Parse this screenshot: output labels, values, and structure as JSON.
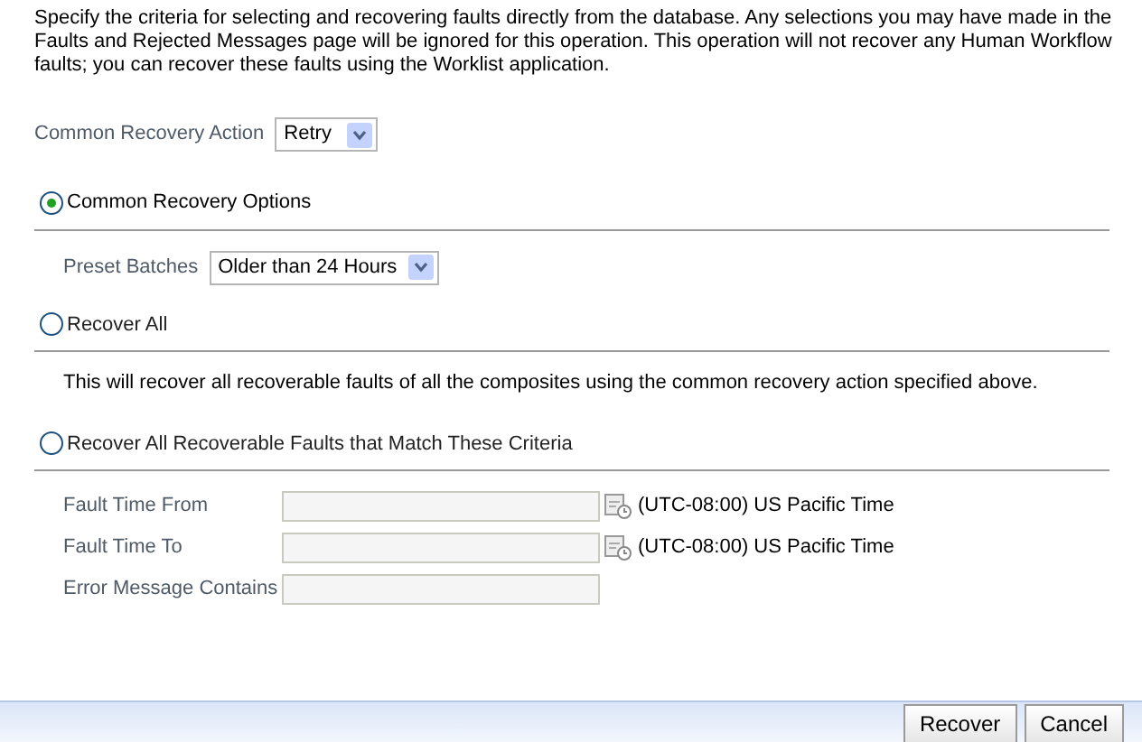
{
  "intro": "Specify the criteria for selecting and recovering faults directly from the database. Any selections you may have made in the Faults and Rejected Messages page will be ignored for this operation. This operation will not recover any Human Workflow faults; you can recover these faults using the Worklist application.",
  "recovery_action": {
    "label": "Common Recovery Action",
    "value": "Retry"
  },
  "options": [
    {
      "kind": "preset",
      "label": "Common Recovery Options",
      "selected": true,
      "preset": {
        "label": "Preset Batches",
        "value": "Older than 24 Hours"
      }
    },
    {
      "kind": "note",
      "label": "Recover All",
      "selected": false,
      "note": "This will recover all recoverable faults of all the composites using the common recovery action specified above."
    },
    {
      "kind": "criteria",
      "label": "Recover All Recoverable Faults that Match These Criteria",
      "selected": false,
      "fields": [
        {
          "label": "Fault Time From",
          "date": true,
          "timezone": "(UTC-08:00) US Pacific Time",
          "disabled": true
        },
        {
          "label": "Fault Time To",
          "date": true,
          "timezone": "(UTC-08:00) US Pacific Time",
          "disabled": true
        },
        {
          "label": "Error Message Contains",
          "date": false,
          "disabled": true
        }
      ]
    }
  ],
  "buttons": [
    "Recover",
    "Cancel"
  ]
}
